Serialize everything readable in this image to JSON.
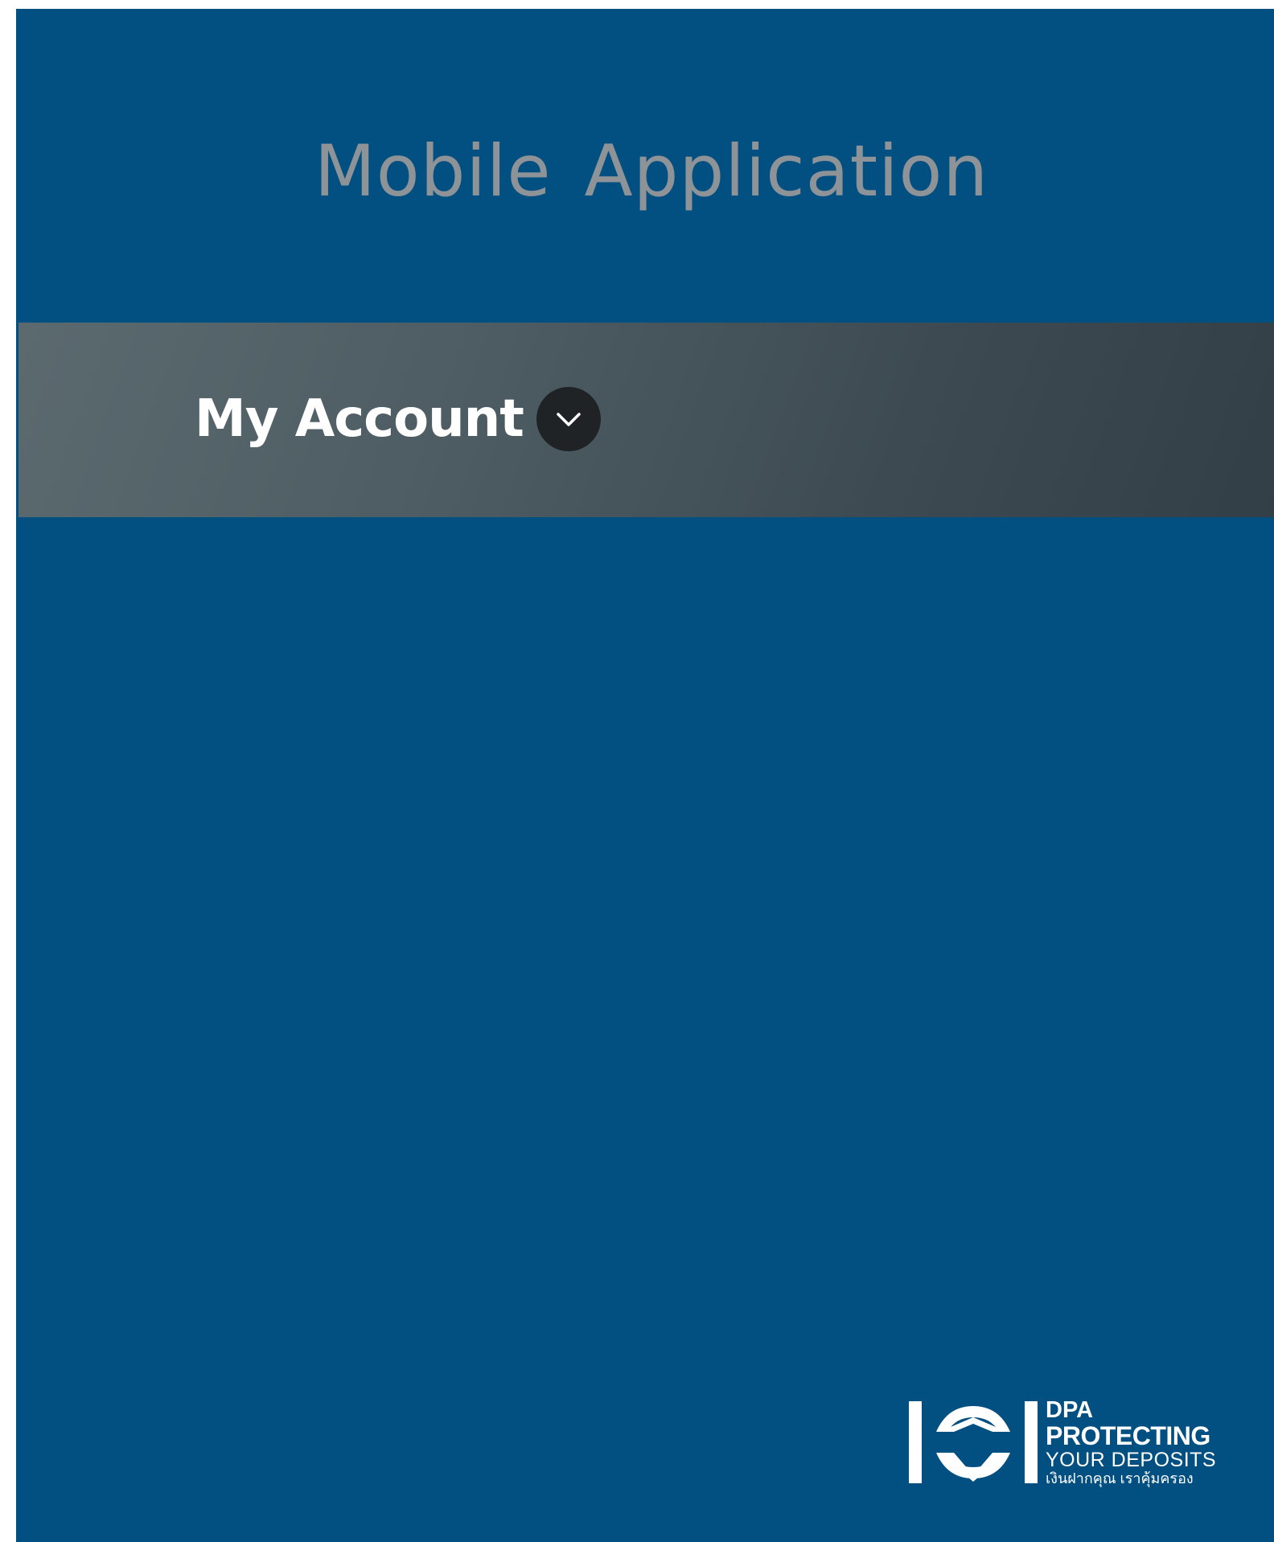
{
  "header": {
    "title": "Mobile Application"
  },
  "account_bar": {
    "label": "My Account",
    "toggle_icon": "chevron-down-icon"
  },
  "logo": {
    "line1": "DPA",
    "line2": "PROTECTING",
    "line3": "YOUR DEPOSITS",
    "line4": "เงินฝากคุณ เราคุ้มครอง"
  },
  "colors": {
    "background": "#024f81",
    "title": "#8e9397",
    "bar": "#4d5d63",
    "chevron_bg": "#1f2326"
  }
}
